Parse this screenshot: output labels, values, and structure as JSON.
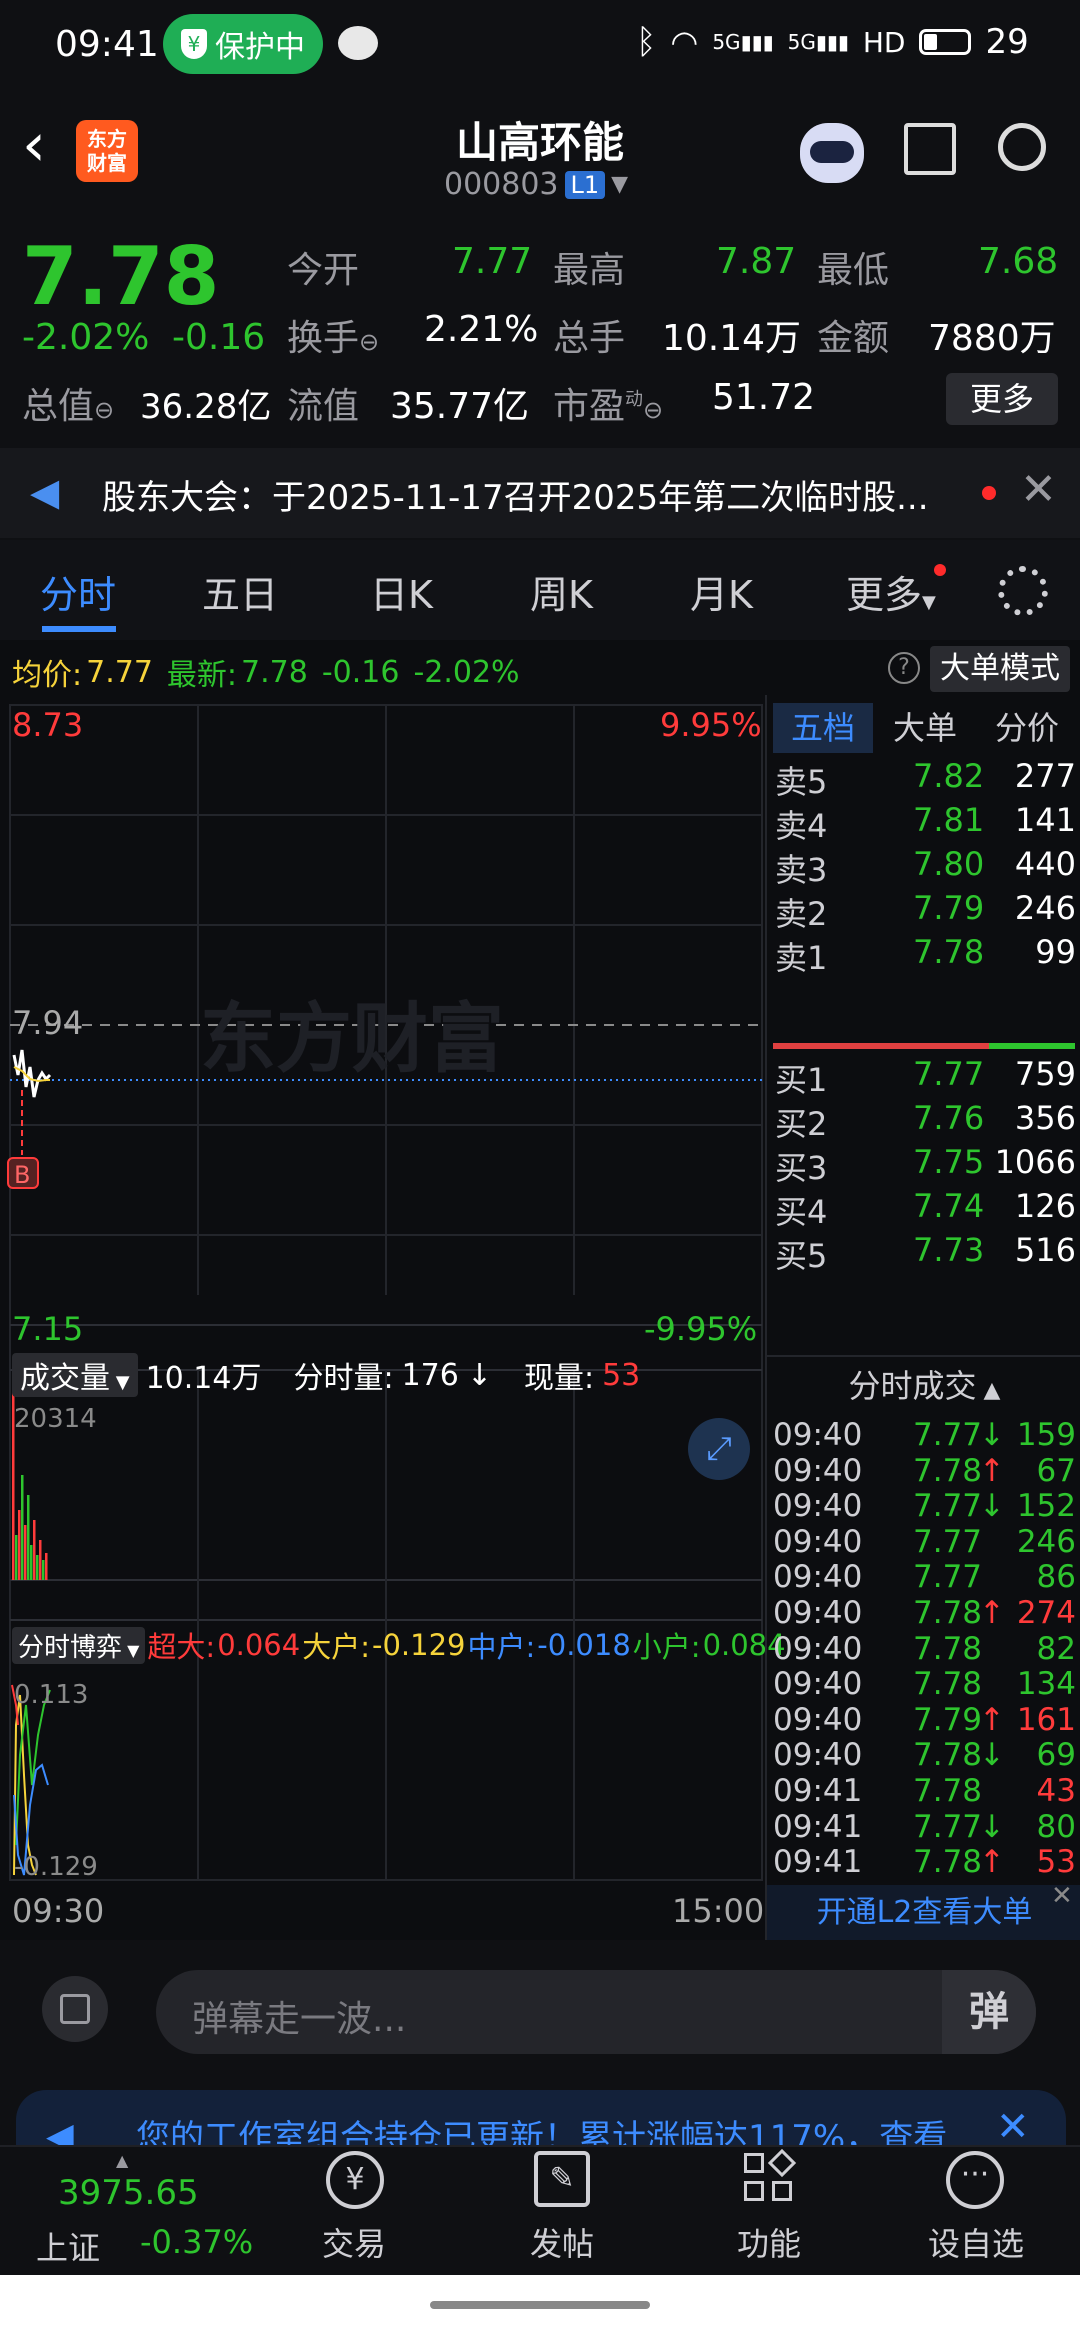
{
  "status": {
    "time": "09:41",
    "protect": "保护中",
    "signal1": "5G",
    "signal2": "5G",
    "hd": "HD",
    "battery": "29"
  },
  "header": {
    "logo_line1": "东方",
    "logo_line2": "财富",
    "name": "山高环能",
    "code": "000803",
    "level": "L1"
  },
  "quote": {
    "price": "7.78",
    "pct": "-2.02%",
    "chg": "-0.16",
    "open_label": "今开",
    "open": "7.77",
    "high_label": "最高",
    "high": "7.87",
    "low_label": "最低",
    "low": "7.68",
    "turnover_label": "换手",
    "turnover": "2.21%",
    "volume_label": "总手",
    "volume": "10.14万",
    "amount_label": "金额",
    "amount": "7880万",
    "mcap_label": "总值",
    "mcap": "36.28亿",
    "float_label": "流值",
    "float": "35.77亿",
    "pe_label": "市盈",
    "pe_sup": "动",
    "pe": "51.72",
    "more": "更多"
  },
  "notice": {
    "text": "股东大会：于2025-11-17召开2025年第二次临时股..."
  },
  "tabs": [
    "分时",
    "五日",
    "日K",
    "周K",
    "月K",
    "更多"
  ],
  "infobar": {
    "avg_label": "均价:",
    "avg": "7.77",
    "last_label": "最新:",
    "last": "7.78",
    "chg": "-0.16",
    "pct": "-2.02%",
    "mode": "大单模式"
  },
  "chart": {
    "y_top": "8.73",
    "pct_top": "9.95%",
    "y_mid": "7.94",
    "y_bot": "7.15",
    "pct_bot": "-9.95%",
    "watermark": "东方财富",
    "marker": "B",
    "time_start": "09:30",
    "time_end": "15:00"
  },
  "volume": {
    "label": "成交量",
    "total": "10.14万",
    "fenshi_label": "分时量:",
    "fenshi": "176",
    "arrow": "↓",
    "now_label": "现量:",
    "now": "53",
    "max": "20314"
  },
  "bo": {
    "label": "分时博弈",
    "chaoda_label": "超大:",
    "chaoda": "0.064",
    "dahu_label": "大户:",
    "dahu": "-0.129",
    "zhonghu_label": "中户:",
    "zhonghu": "-0.018",
    "xiaohu_label": "小户:",
    "xiaohu": "0.084",
    "top": "0.113",
    "bot": "-0.129"
  },
  "orderbook": {
    "tabs": [
      "五档",
      "大单",
      "分价"
    ],
    "sells": [
      {
        "label": "卖5",
        "price": "7.82",
        "vol": "277"
      },
      {
        "label": "卖4",
        "price": "7.81",
        "vol": "141"
      },
      {
        "label": "卖3",
        "price": "7.80",
        "vol": "440"
      },
      {
        "label": "卖2",
        "price": "7.79",
        "vol": "246"
      },
      {
        "label": "卖1",
        "price": "7.78",
        "vol": "99"
      }
    ],
    "buys": [
      {
        "label": "买1",
        "price": "7.77",
        "vol": "759"
      },
      {
        "label": "买2",
        "price": "7.76",
        "vol": "356"
      },
      {
        "label": "买3",
        "price": "7.75",
        "vol": "1066"
      },
      {
        "label": "买4",
        "price": "7.74",
        "vol": "126"
      },
      {
        "label": "买5",
        "price": "7.73",
        "vol": "516"
      }
    ],
    "trades_title": "分时成交",
    "trades": [
      {
        "time": "09:40",
        "price": "7.77",
        "dir": "↓",
        "vol": "159",
        "c": "green"
      },
      {
        "time": "09:40",
        "price": "7.78",
        "dir": "↑",
        "vol": "67",
        "c": "green"
      },
      {
        "time": "09:40",
        "price": "7.77",
        "dir": "↓",
        "vol": "152",
        "c": "green"
      },
      {
        "time": "09:40",
        "price": "7.77",
        "dir": "",
        "vol": "246",
        "c": "green"
      },
      {
        "time": "09:40",
        "price": "7.77",
        "dir": "",
        "vol": "86",
        "c": "green"
      },
      {
        "time": "09:40",
        "price": "7.78",
        "dir": "↑",
        "vol": "274",
        "c": "red"
      },
      {
        "time": "09:40",
        "price": "7.78",
        "dir": "",
        "vol": "82",
        "c": "green"
      },
      {
        "time": "09:40",
        "price": "7.78",
        "dir": "",
        "vol": "134",
        "c": "green"
      },
      {
        "time": "09:40",
        "price": "7.79",
        "dir": "↑",
        "vol": "161",
        "c": "red"
      },
      {
        "time": "09:40",
        "price": "7.78",
        "dir": "↓",
        "vol": "69",
        "c": "green"
      },
      {
        "time": "09:41",
        "price": "7.78",
        "dir": "",
        "vol": "43",
        "c": "red"
      },
      {
        "time": "09:41",
        "price": "7.77",
        "dir": "↓",
        "vol": "80",
        "c": "green"
      },
      {
        "time": "09:41",
        "price": "7.78",
        "dir": "↑",
        "vol": "53",
        "c": "red"
      }
    ],
    "l2": "开通L2查看大单"
  },
  "comment": {
    "placeholder": "弹幕走一波...",
    "danmu": "弹"
  },
  "banner": {
    "text": "您的工作室组合持仓已更新！累计涨幅达117%，查看"
  },
  "nav": {
    "index_val": "3975.65",
    "index_name": "上证",
    "index_pct": "-0.37%",
    "items": [
      "交易",
      "发帖",
      "功能",
      "设自选"
    ]
  },
  "colors": {
    "red": "#ff3b3b",
    "green": "#2ec52e",
    "yellow": "#f6d33b",
    "blue": "#3d8cff",
    "bg": "#0f1013"
  }
}
